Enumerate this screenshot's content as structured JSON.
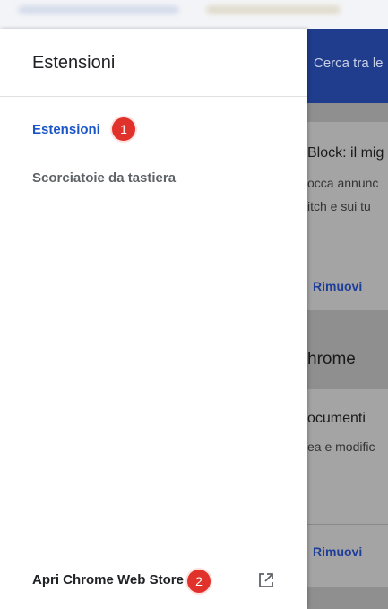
{
  "drawer": {
    "title": "Estensioni",
    "nav_items": [
      {
        "label": "Estensioni",
        "badge": "1",
        "selected": true
      },
      {
        "label": "Scorciatoie da tastiera"
      }
    ],
    "footer": {
      "label": "Apri Chrome Web Store",
      "badge": "2",
      "icon": "open-in-new-icon"
    }
  },
  "background": {
    "search_placeholder": "Cerca tra le",
    "card1": {
      "title": "Block: il mig",
      "line1": "occa annunc",
      "line2": "itch e sui tu",
      "action": "Rimuovi"
    },
    "section": "hrome",
    "card2": {
      "title": "ocumenti",
      "line1": "ea e modific",
      "action": "Rimuovi"
    }
  },
  "colors": {
    "accent": "#1a56c8",
    "badge": "#e0312a",
    "header": "#203c8c"
  }
}
